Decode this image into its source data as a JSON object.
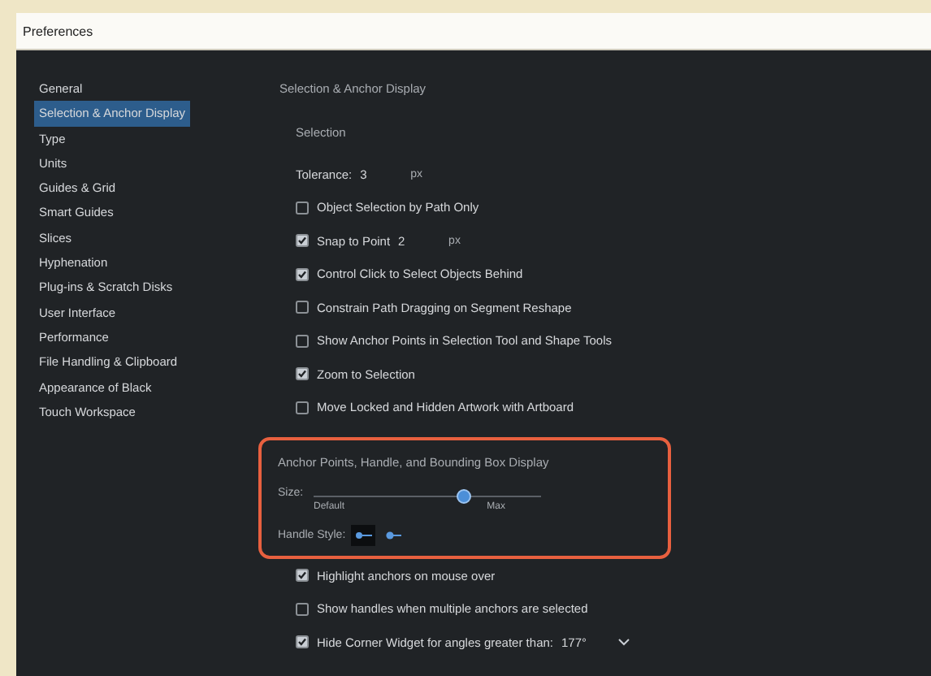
{
  "window": {
    "title": "Preferences"
  },
  "sidebar": {
    "items": [
      {
        "label": "General",
        "selected": false
      },
      {
        "label": "Selection & Anchor Display",
        "selected": true
      },
      {
        "label": "Type",
        "selected": false
      },
      {
        "label": "Units",
        "selected": false
      },
      {
        "label": "Guides & Grid",
        "selected": false
      },
      {
        "label": "Smart Guides",
        "selected": false
      },
      {
        "label": "Slices",
        "selected": false
      },
      {
        "label": "Hyphenation",
        "selected": false
      },
      {
        "label": "Plug-ins & Scratch Disks",
        "selected": false
      },
      {
        "label": "User Interface",
        "selected": false
      },
      {
        "label": "Performance",
        "selected": false
      },
      {
        "label": "File Handling & Clipboard",
        "selected": false
      },
      {
        "label": "Appearance of Black",
        "selected": false
      },
      {
        "label": "Touch Workspace",
        "selected": false
      }
    ]
  },
  "panel": {
    "title": "Selection & Anchor Display",
    "section": "Selection",
    "tolerance": {
      "label": "Tolerance:",
      "value": "3",
      "unit": "px"
    },
    "options": [
      {
        "label": "Object Selection by Path Only",
        "checked": false
      },
      {
        "label": "Snap to Point",
        "checked": true,
        "value": "2",
        "unit": "px"
      },
      {
        "label": "Control Click to Select Objects Behind",
        "checked": true
      },
      {
        "label": "Constrain Path Dragging on Segment Reshape",
        "checked": false
      },
      {
        "label": "Show Anchor Points in Selection Tool and Shape Tools",
        "checked": false
      },
      {
        "label": "Zoom to Selection",
        "checked": true
      },
      {
        "label": "Move Locked and Hidden Artwork with Artboard",
        "checked": false
      }
    ],
    "display": {
      "title": "Anchor Points, Handle, and Bounding Box Display",
      "size_label": "Size:",
      "level": 0.66,
      "min_label": "Default",
      "max_label": "Max",
      "handle_label": "Handle Style:",
      "handle_styles": [
        {
          "selected": true
        },
        {
          "selected": false
        }
      ]
    },
    "more_options": [
      {
        "label": "Highlight anchors on mouse over",
        "checked": true
      },
      {
        "label": "Show handles when multiple anchors are selected",
        "checked": false
      },
      {
        "label": "Hide Corner Widget for angles greater than:",
        "checked": true,
        "value": "177°"
      }
    ]
  }
}
